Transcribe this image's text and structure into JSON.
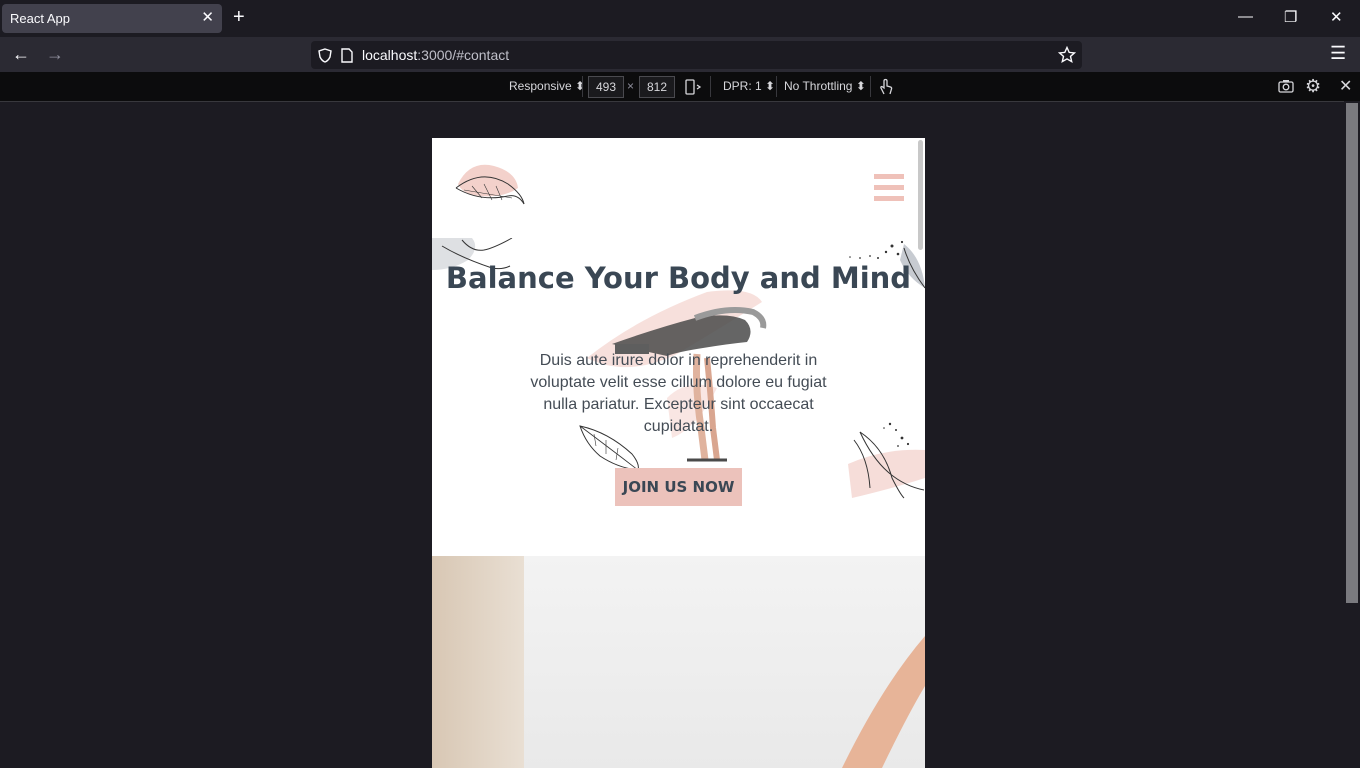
{
  "browser": {
    "tab_title": "React App",
    "url_host": "localhost",
    "url_path": ":3000/#contact"
  },
  "rdm": {
    "device": "Responsive",
    "width": "493",
    "times": "×",
    "height": "812",
    "dpr": "DPR: 1",
    "throttling": "No Throttling"
  },
  "page": {
    "heading": "Balance Your Body and Mind",
    "paragraph": "Duis aute irure dolor in reprehenderit in voluptate velit esse cillum dolore eu fugiat nulla pariatur. Excepteur sint occaecat cupidatat.",
    "cta_label": "JOIN US NOW"
  },
  "colors": {
    "accent": "#ecc2bb",
    "heading": "#3a4754",
    "browser_bg": "#1c1b22"
  },
  "icons": [
    "close-icon",
    "plus-icon",
    "minimize-icon",
    "restore-icon",
    "back-icon",
    "forward-icon",
    "shield-icon",
    "page-icon",
    "star-icon",
    "menu-icon",
    "rotate-icon",
    "touch-icon",
    "screenshot-icon",
    "settings-icon",
    "hamburger-icon"
  ]
}
